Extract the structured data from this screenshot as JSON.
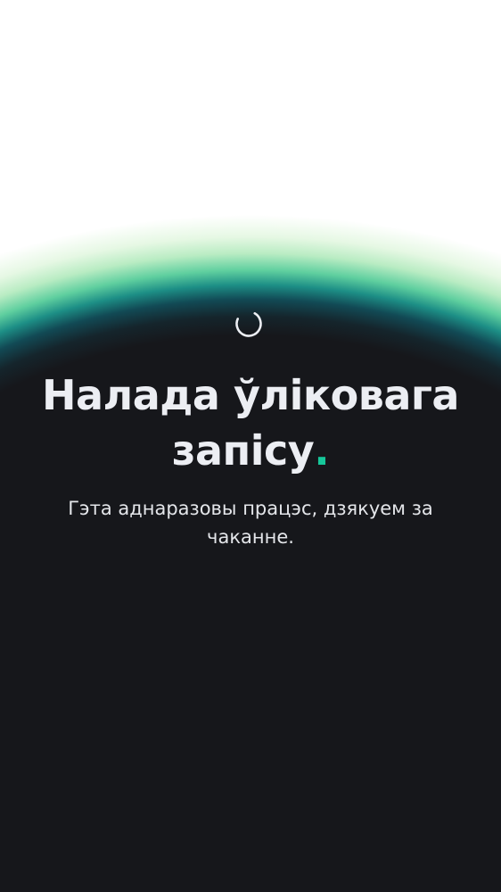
{
  "screen": {
    "title_line1": "Налада ўліковага",
    "title_line2": "запісу",
    "title_accent": ".",
    "subtitle": "Гэта аднаразовы працэс, дзякуем за чаканне."
  },
  "spinner": {
    "icon": "loading-spinner-icon"
  },
  "colors": {
    "background": "#16171b",
    "accent": "#16c79a",
    "glow_teal": "#1d8f86",
    "glow_green": "#b9ecc3",
    "text": "#eceef3"
  }
}
